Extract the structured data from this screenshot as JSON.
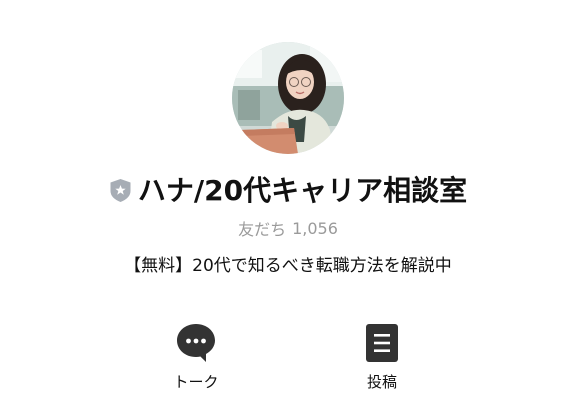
{
  "profile": {
    "name": "ハナ/20代キャリア相談室",
    "friends_label": "友だち",
    "friends_count": "1,056",
    "description": "【無料】20代で知るべき転職方法を解説中",
    "avatar": "profile-photo-woman-with-laptop",
    "badge": "certified-shield-star-icon"
  },
  "actions": {
    "talk_label": "トーク",
    "posts_label": "投稿",
    "talk_icon": "speech-bubble-icon",
    "posts_icon": "document-list-icon"
  },
  "colors": {
    "text": "#111111",
    "secondary_text": "#9a9a9a",
    "icon_dark": "#333333",
    "badge_gray": "#a7adb5"
  }
}
